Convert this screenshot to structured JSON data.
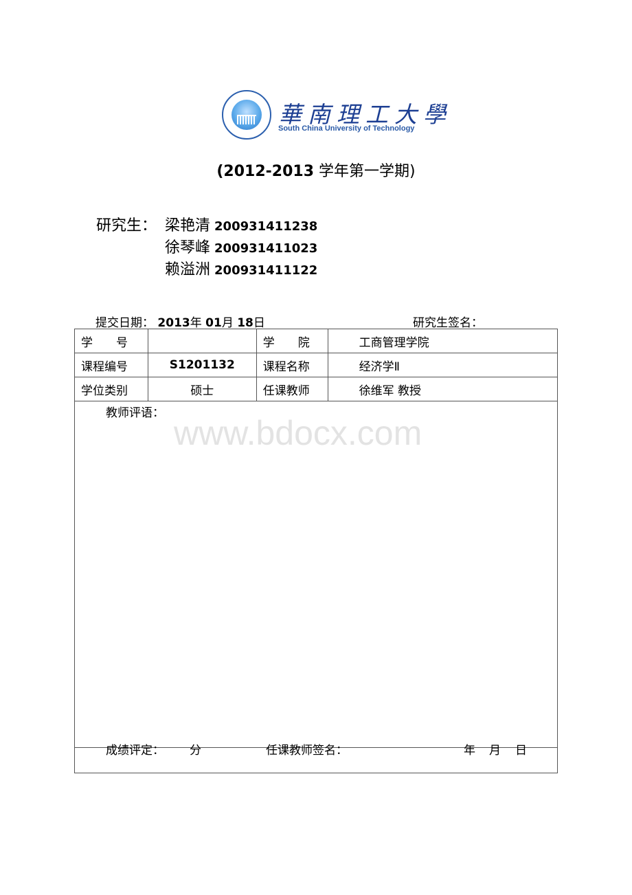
{
  "logo": {
    "emblem_icon": "university-emblem-icon",
    "name_cn": "華南理工大學",
    "name_en": "South China University of Technology"
  },
  "semester": {
    "years": "(2012-2013",
    "term": " 学年第一学期)"
  },
  "students": {
    "label": "研究生：",
    "list": [
      {
        "name": "梁艳清",
        "id": "200931411238"
      },
      {
        "name": "徐琴峰",
        "id": "200931411023"
      },
      {
        "name": "赖溢洲",
        "id": "200931411122"
      }
    ]
  },
  "submission": {
    "label": "提交日期：",
    "year": "2013",
    "year_unit": "年",
    "month": "01",
    "month_unit": "月",
    "day": "18",
    "day_unit": "日",
    "signature_label": "研究生签名："
  },
  "table": {
    "rows": [
      {
        "label1": "学　　号",
        "value1": "",
        "label2": "学　　院",
        "value2": "工商管理学院"
      },
      {
        "label1": "课程编号",
        "value1": "S1201132",
        "label2": "课程名称",
        "value2": "经济学Ⅱ"
      },
      {
        "label1": "学位类别",
        "value1": "硕士",
        "label2": "任课教师",
        "value2": "徐维军  教授"
      }
    ],
    "comments_label": "教师评语：",
    "footer": {
      "grade_label": "成绩评定：",
      "grade_unit": "分",
      "teacher_sign_label": "任课教师签名：",
      "date_year": "年",
      "date_month": "月",
      "date_day": "日"
    }
  },
  "watermark": "www.bdocx.com"
}
